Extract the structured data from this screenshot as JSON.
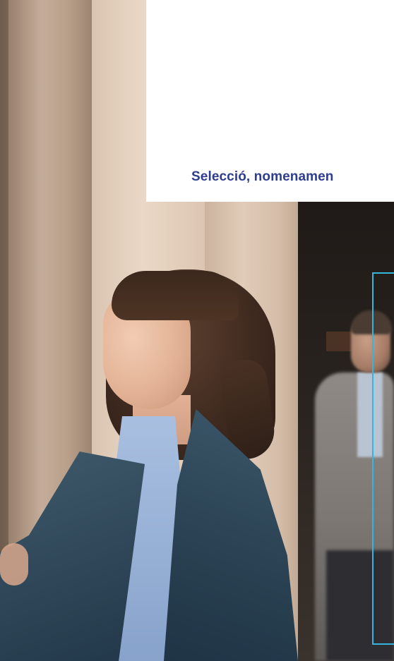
{
  "hero": {
    "title": "Selecció, nomenamen"
  },
  "colors": {
    "title": "#2e3d8f",
    "frame_accent": "#33b5e0",
    "card_background": "#ffffff"
  }
}
